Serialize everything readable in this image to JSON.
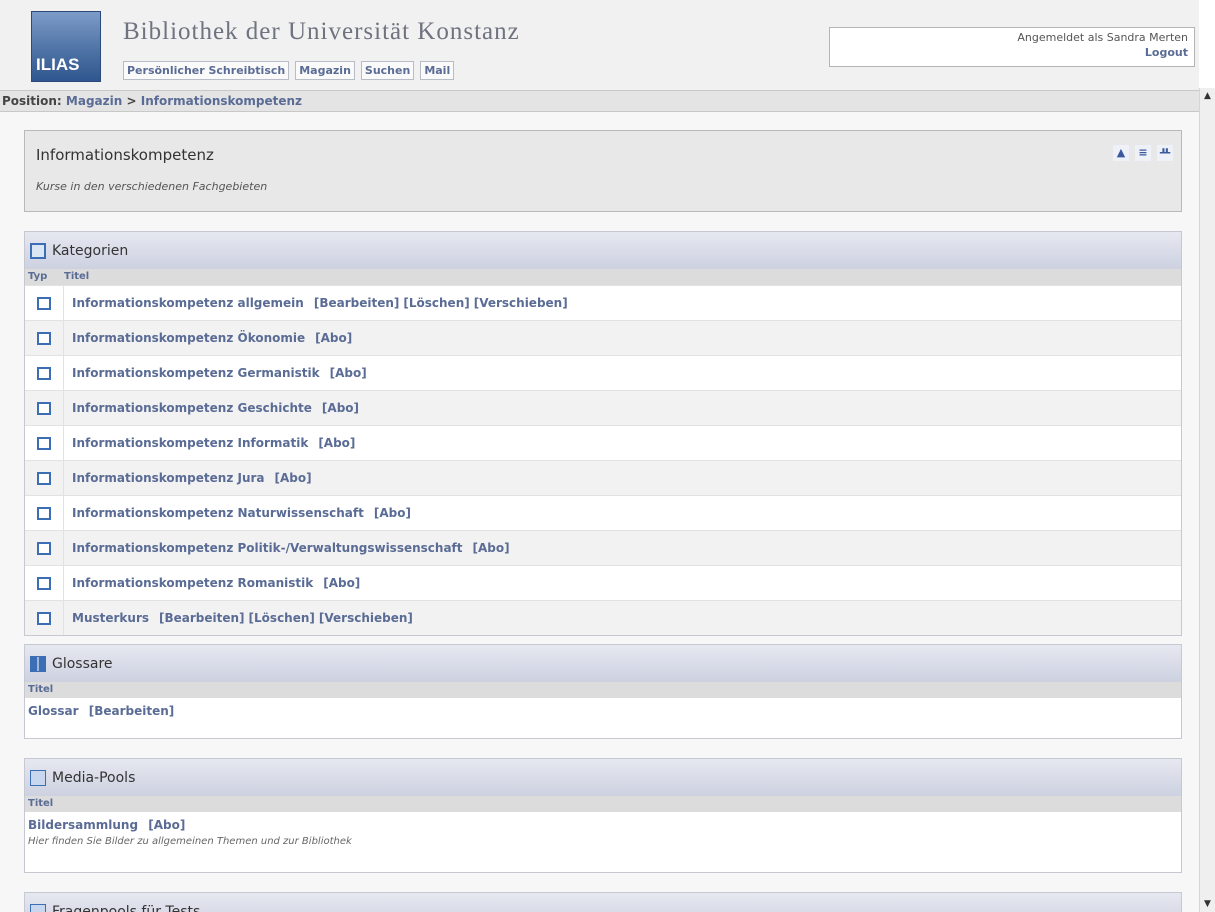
{
  "header": {
    "logo_text": "ILIAS",
    "site_title": "Bibliothek der Universität Konstanz",
    "nav": [
      "Persönlicher Schreibtisch",
      "Magazin",
      "Suchen",
      "Mail"
    ],
    "login_text": "Angemeldet als Sandra Merten",
    "logout_label": "Logout"
  },
  "breadcrumb": {
    "prefix": "Position:",
    "items": [
      "Magazin",
      "Informationskompetenz"
    ],
    "separator": ">"
  },
  "description": {
    "title": "Informationskompetenz",
    "subtitle": "Kurse in den verschiedenen Fachgebieten",
    "icons": [
      "up-icon",
      "list-icon",
      "tree-icon"
    ]
  },
  "categories": {
    "heading": "Kategorien",
    "col_type": "Typ",
    "col_title": "Titel",
    "rows": [
      {
        "title": "Informationskompetenz allgemein",
        "actions": [
          "[Bearbeiten]",
          "[Löschen]",
          "[Verschieben]"
        ]
      },
      {
        "title": "Informationskompetenz Ökonomie",
        "actions": [
          "[Abo]"
        ]
      },
      {
        "title": "Informationskompetenz Germanistik",
        "actions": [
          "[Abo]"
        ]
      },
      {
        "title": "Informationskompetenz Geschichte",
        "actions": [
          "[Abo]"
        ]
      },
      {
        "title": "Informationskompetenz Informatik",
        "actions": [
          "[Abo]"
        ]
      },
      {
        "title": "Informationskompetenz Jura",
        "actions": [
          "[Abo]"
        ]
      },
      {
        "title": "Informationskompetenz Naturwissenschaft",
        "actions": [
          "[Abo]"
        ]
      },
      {
        "title": "Informationskompetenz Politik-/Verwaltungswissenschaft",
        "actions": [
          "[Abo]"
        ]
      },
      {
        "title": "Informationskompetenz Romanistik",
        "actions": [
          "[Abo]"
        ]
      },
      {
        "title": "Musterkurs",
        "actions": [
          "[Bearbeiten]",
          "[Löschen]",
          "[Verschieben]"
        ]
      }
    ]
  },
  "glossare": {
    "heading": "Glossare",
    "col_title": "Titel",
    "item_title": "Glossar",
    "item_action": "[Bearbeiten]"
  },
  "media": {
    "heading": "Media-Pools",
    "col_title": "Titel",
    "item_title": "Bildersammlung",
    "item_action": "[Abo]",
    "item_note": "Hier finden Sie Bilder zu allgemeinen Themen und zur Bibliothek"
  },
  "fragepools": {
    "heading": "Fragenpools für Tests"
  },
  "colors": {
    "link": "#5a6c95",
    "section_header": "#cdd1e0",
    "icon_blue": "#3b6eb4"
  }
}
